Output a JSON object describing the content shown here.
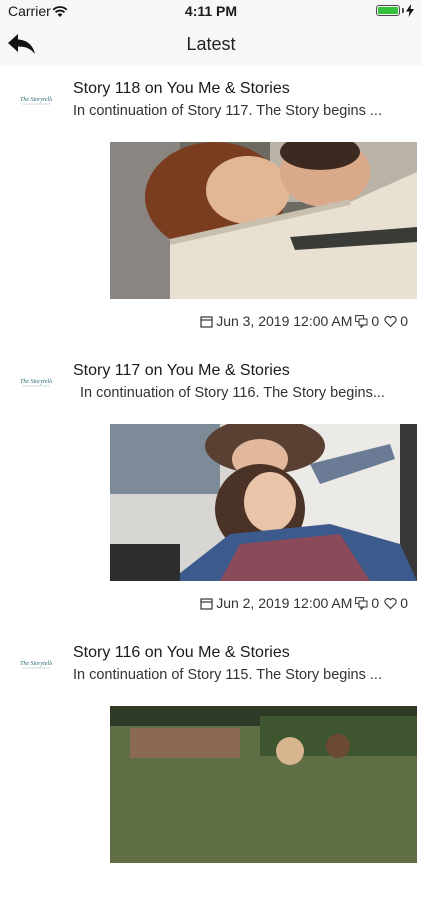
{
  "status_bar": {
    "carrier": "Carrier",
    "time": "4:11 PM",
    "icons": [
      "wifi-icon",
      "battery-icon",
      "charging-icon"
    ],
    "battery_color": "#33c23a"
  },
  "nav": {
    "title": "Latest",
    "back_icon": "reply-arrow-icon"
  },
  "posts": [
    {
      "title": "Story 118 on You Me & Stories",
      "excerpt": "In continuation of Story 117. The Story begins ...",
      "date": "Jun 3, 2019 12:00 AM",
      "comments": "0",
      "likes": "0"
    },
    {
      "title": "Story 117 on You Me & Stories",
      "excerpt": "In continuation of Story 116. The Story begins...",
      "date": "Jun 2, 2019 12:00 AM",
      "comments": "0",
      "likes": "0"
    },
    {
      "title": "Story 116 on You Me & Stories",
      "excerpt": "In continuation of Story 115. The Story begins ..."
    }
  ]
}
